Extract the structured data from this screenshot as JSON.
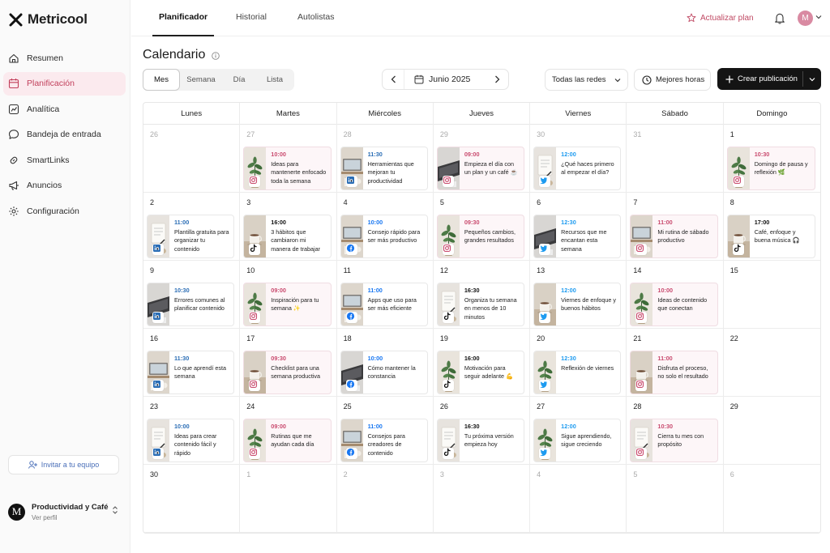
{
  "app": {
    "name": "Metricool"
  },
  "sidebar": {
    "items": [
      {
        "label": "Resumen",
        "icon": "home-icon",
        "active": false
      },
      {
        "label": "Planificación",
        "icon": "calendar-icon",
        "active": true
      },
      {
        "label": "Analítica",
        "icon": "analytics-icon",
        "active": false
      },
      {
        "label": "Bandeja de entrada",
        "icon": "inbox-icon",
        "active": false
      },
      {
        "label": "SmartLinks",
        "icon": "link-icon",
        "active": false
      },
      {
        "label": "Anuncios",
        "icon": "megaphone-icon",
        "active": false
      },
      {
        "label": "Configuración",
        "icon": "gear-icon",
        "active": false
      }
    ],
    "invite_label": "Invitar a tu equipo",
    "profile": {
      "initial": "M",
      "name": "Productividad y Café",
      "subtitle": "Ver perfil"
    }
  },
  "topbar": {
    "tabs": [
      {
        "label": "Planificador",
        "active": true
      },
      {
        "label": "Historial",
        "active": false
      },
      {
        "label": "Autolistas",
        "active": false
      }
    ],
    "upgrade_label": "Actualizar plan",
    "user_initial": "M"
  },
  "toolbar": {
    "title": "Calendario",
    "views": [
      {
        "label": "Mes",
        "active": true
      },
      {
        "label": "Semana",
        "active": false
      },
      {
        "label": "Día",
        "active": false
      },
      {
        "label": "Lista",
        "active": false
      }
    ],
    "month_label": "Junio 2025",
    "network_filter": "Todas las redes",
    "best_hours_label": "Mejores horas",
    "create_label": "Crear publicación"
  },
  "colors": {
    "instagram": "#c94a6e",
    "linkedin": "#2a6db5",
    "facebook": "#1877f2",
    "twitter": "#1d9bf0",
    "tiktok": "#111111",
    "accent": "#c2405c"
  },
  "calendar": {
    "weekdays": [
      "Lunes",
      "Martes",
      "Miércoles",
      "Jueves",
      "Viernes",
      "Sábado",
      "Domingo"
    ],
    "days": [
      {
        "day": "26",
        "outside": true,
        "post": null
      },
      {
        "day": "27",
        "outside": true,
        "post": {
          "time": "10:00",
          "caption": "Ideas para mantenerte enfocado toda la semana",
          "network": "instagram",
          "thumb": "plant"
        }
      },
      {
        "day": "28",
        "outside": true,
        "post": {
          "time": "11:30",
          "caption": "Herramientas que mejoran tu productividad",
          "network": "linkedin",
          "thumb": "desk"
        }
      },
      {
        "day": "29",
        "outside": true,
        "post": {
          "time": "09:00",
          "caption": "Empieza el día con un plan y un café ☕",
          "network": "instagram",
          "thumb": "laptop"
        }
      },
      {
        "day": "30",
        "outside": true,
        "post": {
          "time": "12:00",
          "caption": "¿Qué haces primero al empezar el día?",
          "network": "twitter",
          "thumb": "notebook"
        }
      },
      {
        "day": "31",
        "outside": true,
        "post": null
      },
      {
        "day": "1",
        "outside": false,
        "post": {
          "time": "10:30",
          "caption": "Domingo de pausa y reflexión 🌿",
          "network": "instagram",
          "thumb": "plant"
        }
      },
      {
        "day": "2",
        "outside": false,
        "post": {
          "time": "11:00",
          "caption": "Plantilla gratuita para organizar tu contenido",
          "network": "linkedin",
          "thumb": "notebook"
        }
      },
      {
        "day": "3",
        "outside": false,
        "post": {
          "time": "16:00",
          "caption": "3 hábitos que cambiaron mi manera de trabajar",
          "network": "tiktok",
          "thumb": "coffee"
        }
      },
      {
        "day": "4",
        "outside": false,
        "post": {
          "time": "10:00",
          "caption": "Consejo rápido para ser más productivo",
          "network": "facebook",
          "thumb": "desk"
        }
      },
      {
        "day": "5",
        "outside": false,
        "post": {
          "time": "09:30",
          "caption": "Pequeños cambios, grandes resultados",
          "network": "instagram",
          "thumb": "plant"
        }
      },
      {
        "day": "6",
        "outside": false,
        "post": {
          "time": "12:30",
          "caption": "Recursos que me encantan esta semana",
          "network": "twitter",
          "thumb": "laptop"
        }
      },
      {
        "day": "7",
        "outside": false,
        "post": {
          "time": "11:00",
          "caption": "Mi rutina de sábado productivo",
          "network": "instagram",
          "thumb": "desk"
        }
      },
      {
        "day": "8",
        "outside": false,
        "post": {
          "time": "17:00",
          "caption": "Café, enfoque y buena música 🎧",
          "network": "tiktok",
          "thumb": "coffee"
        }
      },
      {
        "day": "9",
        "outside": false,
        "post": {
          "time": "10:30",
          "caption": "Errores comunes al planificar contenido",
          "network": "linkedin",
          "thumb": "laptop"
        }
      },
      {
        "day": "10",
        "outside": false,
        "post": {
          "time": "09:00",
          "caption": "Inspiración para tu semana ✨",
          "network": "instagram",
          "thumb": "plant"
        }
      },
      {
        "day": "11",
        "outside": false,
        "post": {
          "time": "11:00",
          "caption": "Apps que uso para ser más eficiente",
          "network": "facebook",
          "thumb": "desk"
        }
      },
      {
        "day": "12",
        "outside": false,
        "post": {
          "time": "16:30",
          "caption": "Organiza tu semana en menos de 10 minutos",
          "network": "tiktok",
          "thumb": "notebook"
        }
      },
      {
        "day": "13",
        "outside": false,
        "post": {
          "time": "12:00",
          "caption": "Viernes de enfoque y buenos hábitos",
          "network": "twitter",
          "thumb": "coffee"
        }
      },
      {
        "day": "14",
        "outside": false,
        "post": {
          "time": "10:00",
          "caption": "Ideas de contenido que conectan",
          "network": "instagram",
          "thumb": "plant"
        }
      },
      {
        "day": "15",
        "outside": false,
        "post": null
      },
      {
        "day": "16",
        "outside": false,
        "post": {
          "time": "11:30",
          "caption": "Lo que aprendí esta semana",
          "network": "linkedin",
          "thumb": "desk"
        }
      },
      {
        "day": "17",
        "outside": false,
        "post": {
          "time": "09:30",
          "caption": "Checklist para una semana productiva",
          "network": "instagram",
          "thumb": "coffee"
        }
      },
      {
        "day": "18",
        "outside": false,
        "post": {
          "time": "10:00",
          "caption": "Cómo mantener la constancia",
          "network": "facebook",
          "thumb": "laptop"
        }
      },
      {
        "day": "19",
        "outside": false,
        "post": {
          "time": "16:00",
          "caption": "Motivación para seguir adelante 💪",
          "network": "tiktok",
          "thumb": "plant"
        }
      },
      {
        "day": "20",
        "outside": false,
        "post": {
          "time": "12:30",
          "caption": "Reflexión de viernes",
          "network": "twitter",
          "thumb": "plant"
        }
      },
      {
        "day": "21",
        "outside": false,
        "post": {
          "time": "11:00",
          "caption": "Disfruta el proceso, no solo el resultado",
          "network": "instagram",
          "thumb": "coffee"
        }
      },
      {
        "day": "22",
        "outside": false,
        "post": null
      },
      {
        "day": "23",
        "outside": false,
        "post": {
          "time": "10:00",
          "caption": "Ideas para crear contenido fácil y rápido",
          "network": "linkedin",
          "thumb": "notebook"
        }
      },
      {
        "day": "24",
        "outside": false,
        "post": {
          "time": "09:00",
          "caption": "Rutinas que me ayudan cada día",
          "network": "instagram",
          "thumb": "plant"
        }
      },
      {
        "day": "25",
        "outside": false,
        "post": {
          "time": "11:00",
          "caption": "Consejos para creadores de contenido",
          "network": "facebook",
          "thumb": "desk"
        }
      },
      {
        "day": "26",
        "outside": false,
        "post": {
          "time": "16:30",
          "caption": "Tu próxima versión empieza hoy",
          "network": "tiktok",
          "thumb": "notebook"
        }
      },
      {
        "day": "27",
        "outside": false,
        "post": {
          "time": "12:00",
          "caption": "Sigue aprendiendo, sigue creciendo",
          "network": "twitter",
          "thumb": "plant"
        }
      },
      {
        "day": "28",
        "outside": false,
        "post": {
          "time": "10:30",
          "caption": "Cierra tu mes con propósito",
          "network": "instagram",
          "thumb": "notebook"
        }
      },
      {
        "day": "29",
        "outside": false,
        "post": null
      },
      {
        "day": "30",
        "outside": false,
        "post": null
      },
      {
        "day": "1",
        "outside": true,
        "post": null
      },
      {
        "day": "2",
        "outside": true,
        "post": null
      },
      {
        "day": "3",
        "outside": true,
        "post": null
      },
      {
        "day": "4",
        "outside": true,
        "post": null
      },
      {
        "day": "5",
        "outside": true,
        "post": null
      },
      {
        "day": "6",
        "outside": true,
        "post": null
      }
    ]
  }
}
